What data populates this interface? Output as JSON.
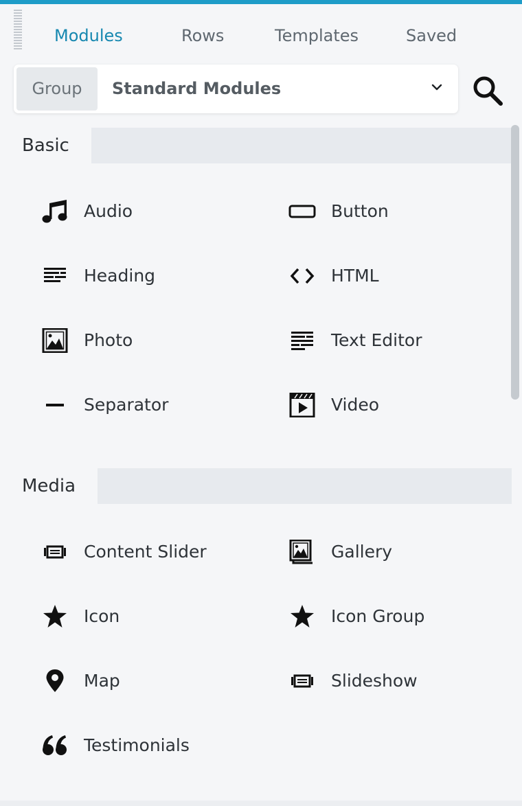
{
  "tabs": [
    {
      "label": "Modules",
      "active": true
    },
    {
      "label": "Rows",
      "active": false
    },
    {
      "label": "Templates",
      "active": false
    },
    {
      "label": "Saved",
      "active": false
    }
  ],
  "group_selector": {
    "label": "Group",
    "value": "Standard Modules"
  },
  "icons": {
    "search": "search-icon",
    "dropdown": "chevron-down-icon"
  },
  "sections": [
    {
      "label": "Basic",
      "modules": [
        {
          "label": "Audio",
          "icon": "music-note-icon"
        },
        {
          "label": "Button",
          "icon": "button-icon"
        },
        {
          "label": "Heading",
          "icon": "heading-icon"
        },
        {
          "label": "HTML",
          "icon": "code-icon"
        },
        {
          "label": "Photo",
          "icon": "photo-icon"
        },
        {
          "label": "Text Editor",
          "icon": "text-editor-icon"
        },
        {
          "label": "Separator",
          "icon": "separator-icon"
        },
        {
          "label": "Video",
          "icon": "video-icon"
        }
      ]
    },
    {
      "label": "Media",
      "modules": [
        {
          "label": "Content Slider",
          "icon": "slider-icon"
        },
        {
          "label": "Gallery",
          "icon": "gallery-icon"
        },
        {
          "label": "Icon",
          "icon": "star-icon"
        },
        {
          "label": "Icon Group",
          "icon": "star-icon"
        },
        {
          "label": "Map",
          "icon": "map-pin-icon"
        },
        {
          "label": "Slideshow",
          "icon": "slideshow-icon"
        },
        {
          "label": "Testimonials",
          "icon": "quote-icon"
        }
      ]
    }
  ],
  "colors": {
    "accent": "#1788b0",
    "topbar": "#1e9cc8",
    "background": "#f5f6f8",
    "section_header": "#e7eaee"
  }
}
